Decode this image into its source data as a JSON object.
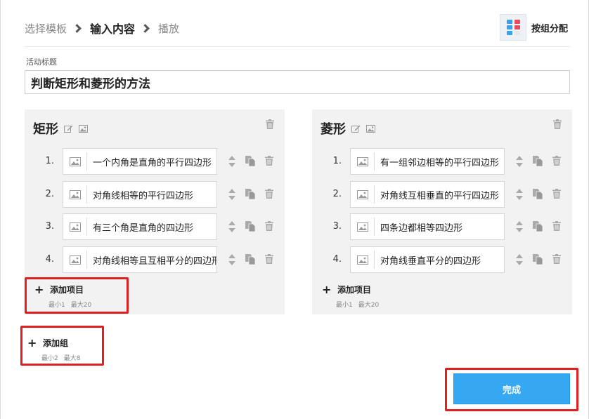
{
  "breadcrumb": {
    "step1": "选择模板",
    "step2": "输入内容",
    "step3": "播放"
  },
  "assign_button": {
    "label": "按组分配",
    "icon": "group-assign-icon"
  },
  "activity": {
    "label": "活动标题",
    "title": "判断矩形和菱形的方法"
  },
  "groups": [
    {
      "name": "矩形",
      "items": [
        {
          "num": "1.",
          "text": "一个内角是直角的平行四边形"
        },
        {
          "num": "2.",
          "text": "对角线相等的平行四边形"
        },
        {
          "num": "3.",
          "text": "有三个角是直角的四边形"
        },
        {
          "num": "4.",
          "text": "对角线相等且互相平分的四边形"
        }
      ],
      "add_item": {
        "label": "添加项目",
        "min": "最小1",
        "max": "最大20"
      }
    },
    {
      "name": "菱形",
      "items": [
        {
          "num": "1.",
          "text": "有一组邻边相等的平行四边形"
        },
        {
          "num": "2.",
          "text": "对角线互相垂直的平行四边形"
        },
        {
          "num": "3.",
          "text": "四条边都相等四边形"
        },
        {
          "num": "4.",
          "text": "对角线垂直平分的四边形"
        }
      ],
      "add_item": {
        "label": "添加项目",
        "min": "最小1",
        "max": "最大20"
      }
    }
  ],
  "add_group": {
    "label": "添加组",
    "min": "最小2",
    "max": "最大8"
  },
  "done_button": {
    "label": "完成"
  },
  "colors": {
    "accent_blue": "#36a8f2",
    "highlight_red": "#e02020",
    "group_bg": "#f2f2f2"
  }
}
